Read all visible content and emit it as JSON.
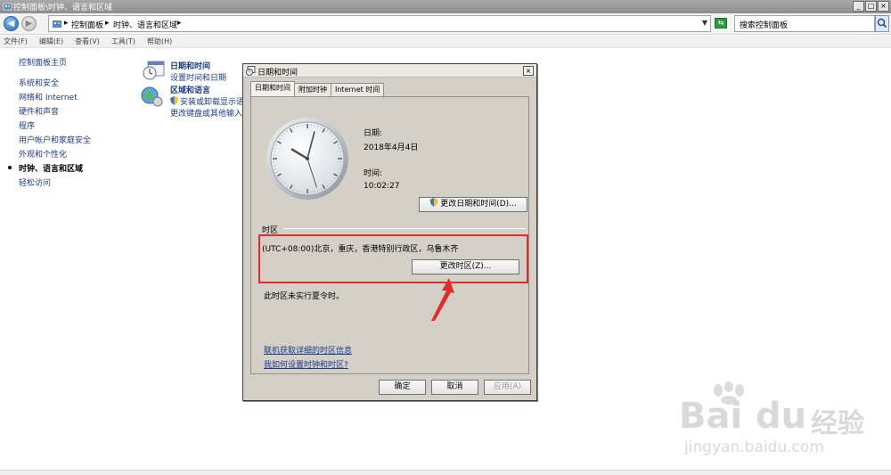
{
  "window": {
    "title": "控制面板\\时钟、语言和区域",
    "buttons": [
      "_",
      "□",
      "×"
    ]
  },
  "address": {
    "crumbs": [
      "控制面板",
      "时钟、语言和区域"
    ],
    "separator": "▸",
    "search_placeholder": "搜索控制面板"
  },
  "menu": [
    "文件(F)",
    "编辑(E)",
    "查看(V)",
    "工具(T)",
    "帮助(H)"
  ],
  "leftnav": {
    "home": "控制面板主页",
    "items": [
      "系统和安全",
      "网络和 Internet",
      "硬件和声音",
      "程序",
      "用户帐户和家庭安全",
      "外观和个性化",
      "时钟、语言和区域",
      "轻松访问"
    ],
    "current_index": 6
  },
  "categories": [
    {
      "title": "日期和时间",
      "links": [
        "设置时间和日期"
      ]
    },
    {
      "title": "区域和语言",
      "links": [
        "安装或卸载显示语",
        "更改键盘或其他输入"
      ]
    }
  ],
  "dialog": {
    "title": "日期和时间",
    "close": "×",
    "tabs": [
      "日期和时间",
      "附加时钟",
      "Internet 时间"
    ],
    "active_tab": 0,
    "date_label": "日期:",
    "date_value": "2018年4月4日",
    "time_label": "时间:",
    "time_value": "10:02:27",
    "change_datetime_button": "更改日期和时间(D)...",
    "timezone_section": "时区",
    "timezone_value": "(UTC+08:00)北京，重庆，香港特别行政区，乌鲁木齐",
    "change_timezone_button": "更改时区(Z)...",
    "dst_note": "此时区未实行夏令时。",
    "link_online": "联机获取详细的时区信息",
    "link_howto": "我如何设置时钟和时区?",
    "ok": "确定",
    "cancel": "取消",
    "apply": "应用(A)"
  },
  "clock": {
    "hours": 10,
    "minutes": 2,
    "seconds": 27
  },
  "watermark": {
    "brand": "Bai",
    "brand2": "du",
    "cn": "经验",
    "url": "jingyan.baidu.com"
  },
  "colors": {
    "highlight": "#e32b2b",
    "link": "#1b3d87"
  }
}
